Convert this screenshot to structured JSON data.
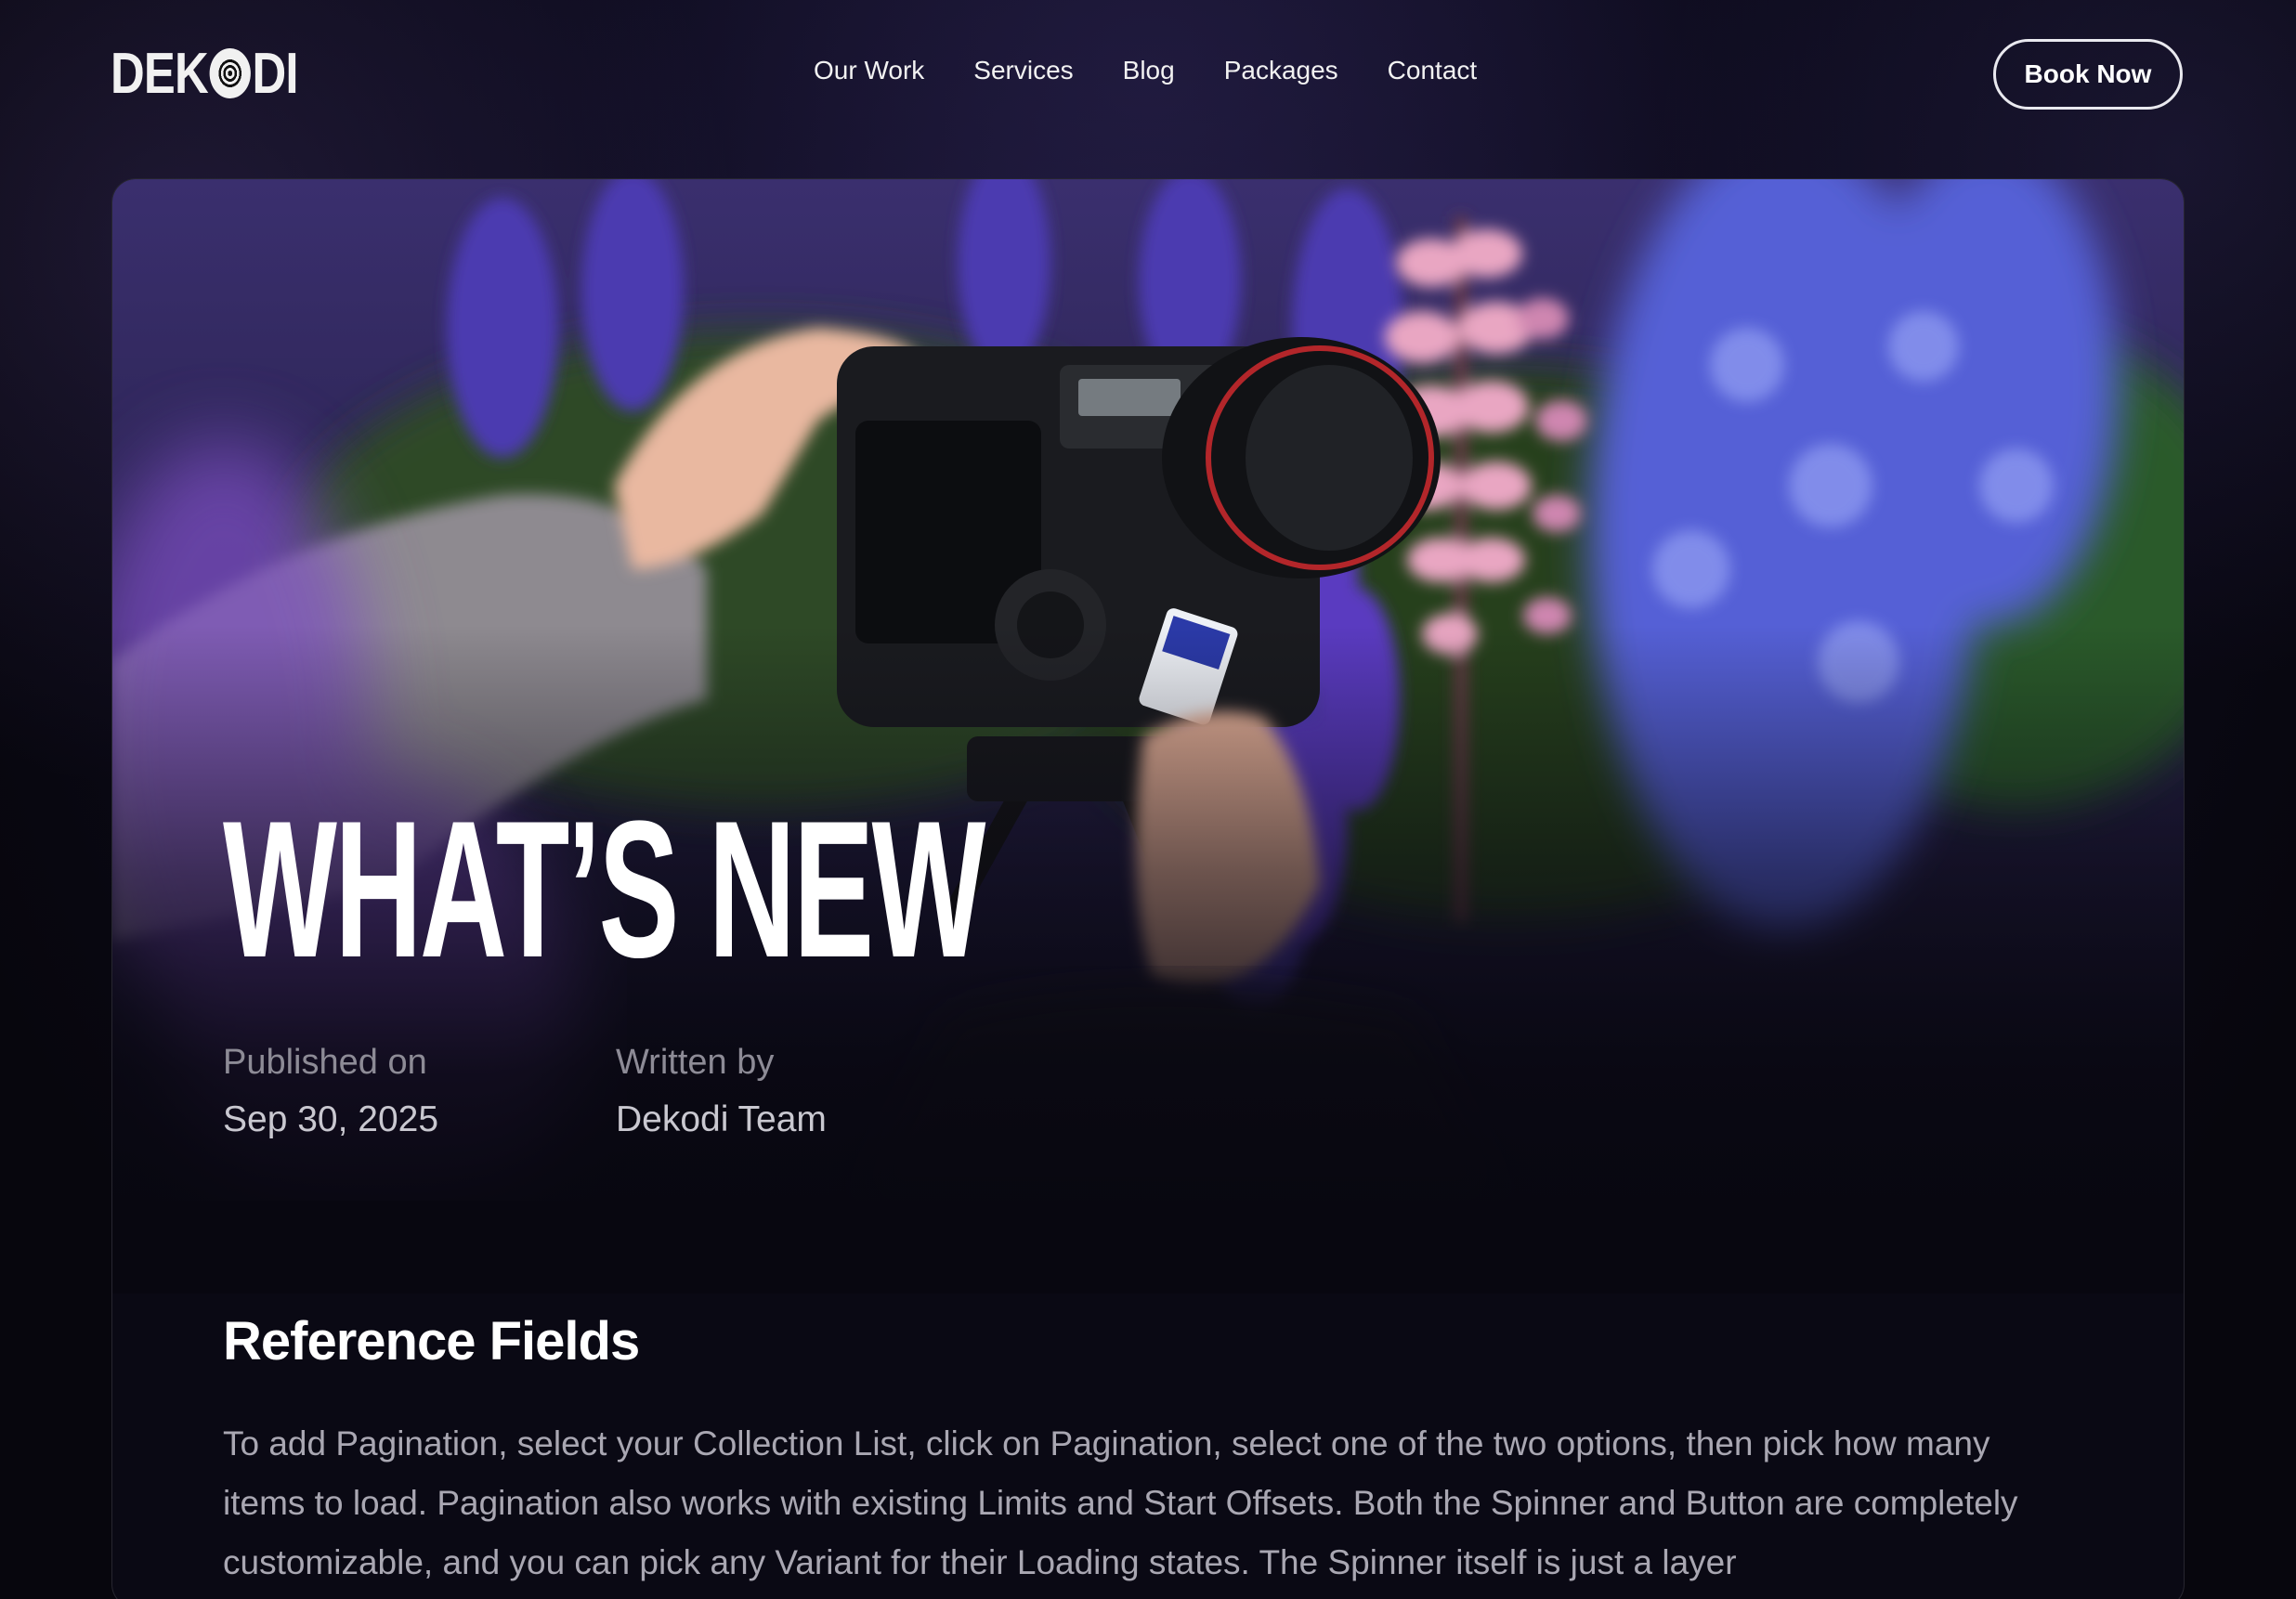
{
  "nav": {
    "logo": "DEKODI",
    "links": [
      "Our Work",
      "Services",
      "Blog",
      "Packages",
      "Contact"
    ],
    "cta": "Book Now"
  },
  "hero": {
    "title": "WHAT’S NEW",
    "published_label": "Published on",
    "published_date": "Sep 30, 2025",
    "author_label": "Written by",
    "author": "Dekodi Team"
  },
  "article": {
    "heading": "Reference Fields",
    "body": "To add Pagination, select your Collection List, click on Pagination, select one of the two options, then pick how many items to load. Pagination also works with existing Limits and Start Offsets. Both the Spinner and Button are completely customizable, and you can pick any Variant for their Loading states. The Spinner itself is just a layer"
  },
  "colors": {
    "background": "#07060d",
    "text_primary": "#ffffff",
    "text_muted": "#a9a7b2",
    "lupine_purple": "#4b2fa3",
    "lupine_pink": "#e9a6c2"
  }
}
